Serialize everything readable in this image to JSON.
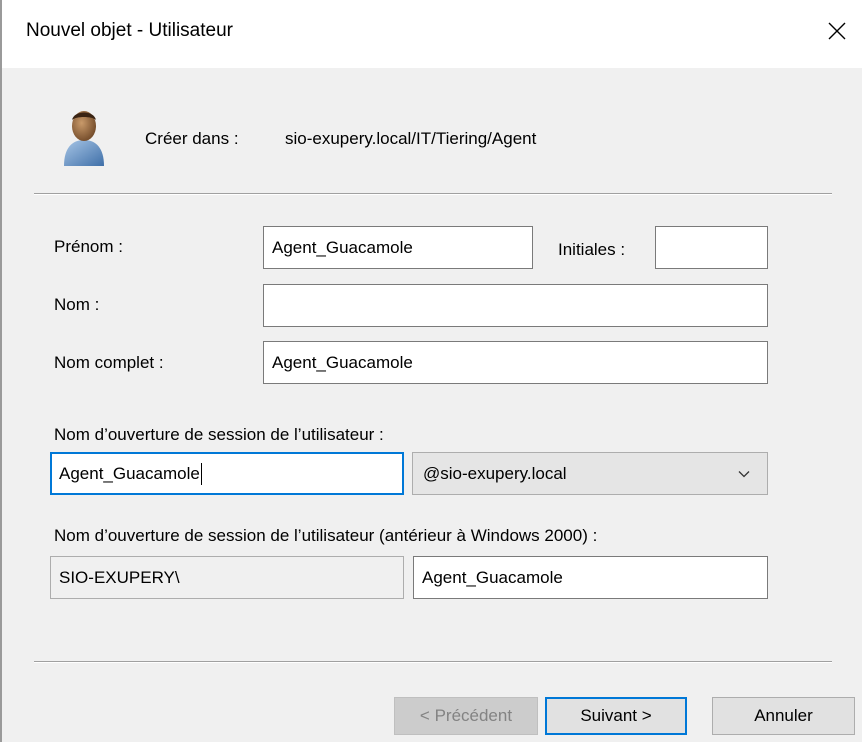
{
  "window": {
    "title": "Nouvel objet - Utilisateur",
    "close_glyph": "✕"
  },
  "header": {
    "create_in_label": "Créer dans :",
    "create_in_path": "sio-exupery.local/IT/Tiering/Agent"
  },
  "form": {
    "first_name_label": "Prénom :",
    "first_name_value": "Agent_Guacamole",
    "initials_label": "Initiales :",
    "initials_value": "",
    "last_name_label": "Nom :",
    "last_name_value": "",
    "full_name_label": "Nom complet :",
    "full_name_value": "Agent_Guacamole",
    "logon_label": "Nom d’ouverture de session de l’utilisateur :",
    "logon_value": "Agent_Guacamole",
    "domain_selected": "@sio-exupery.local",
    "pre2000_label": "Nom d’ouverture de session de l’utilisateur (antérieur à Windows 2000) :",
    "pre2000_domain": "SIO-EXUPERY\\",
    "pre2000_value": "Agent_Guacamole"
  },
  "buttons": {
    "previous": "< Précédent",
    "next": "Suivant >",
    "cancel": "Annuler"
  },
  "colors": {
    "accent": "#0078d7",
    "window_bg": "#f0f0f0",
    "titlebar_bg": "#ffffff"
  },
  "icons": {
    "close": "close-icon",
    "user": "user-icon",
    "dropdown": "chevron-down-icon"
  }
}
